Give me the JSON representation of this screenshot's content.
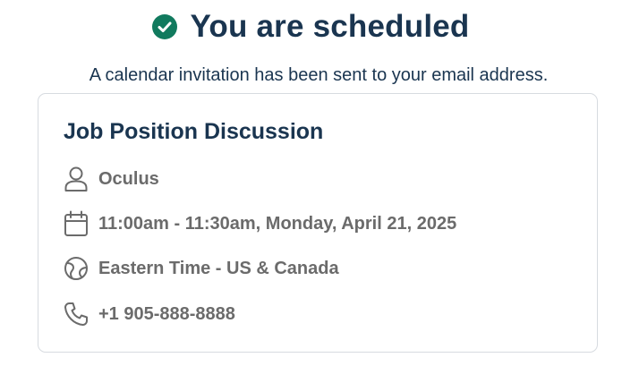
{
  "header": {
    "title": "You are scheduled",
    "subtitle": "A calendar invitation has been sent to your email address."
  },
  "event": {
    "name": "Job Position Discussion",
    "details": {
      "host": "Oculus",
      "time": "11:00am - 11:30am, Monday, April 21, 2025",
      "timezone": "Eastern Time - US & Canada",
      "phone": "+1 905-888-8888"
    }
  },
  "icons": {
    "check": "check-circle-icon",
    "host": "person-icon",
    "time": "calendar-icon",
    "timezone": "globe-icon",
    "phone": "phone-icon"
  },
  "colors": {
    "success": "#117a5e",
    "heading": "#1a3550",
    "detail_text": "#6b6b6b",
    "card_border": "#d7dbe0"
  }
}
